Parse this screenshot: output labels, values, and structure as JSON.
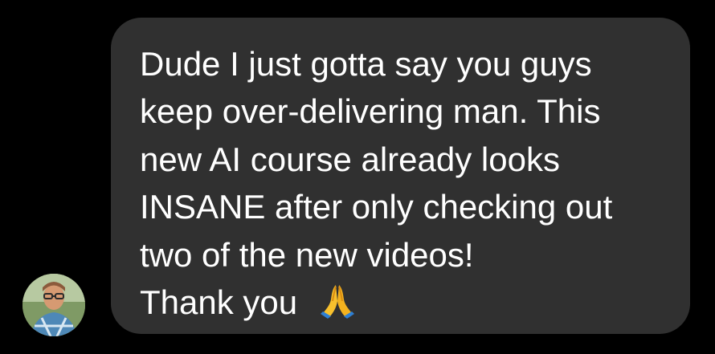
{
  "message": {
    "lines": [
      "Dude I just gotta say you guys",
      "keep over-delivering man. This",
      "new AI course already looks",
      "INSANE after only checking out",
      "two of the new videos!",
      "Thank you"
    ],
    "emoji_icon": "folded-hands-icon"
  },
  "colors": {
    "background": "#000000",
    "bubble": "#303030",
    "text": "#ffffff",
    "emoji": "#f6b82b"
  },
  "avatar": {
    "icon": "user-avatar-photo"
  }
}
